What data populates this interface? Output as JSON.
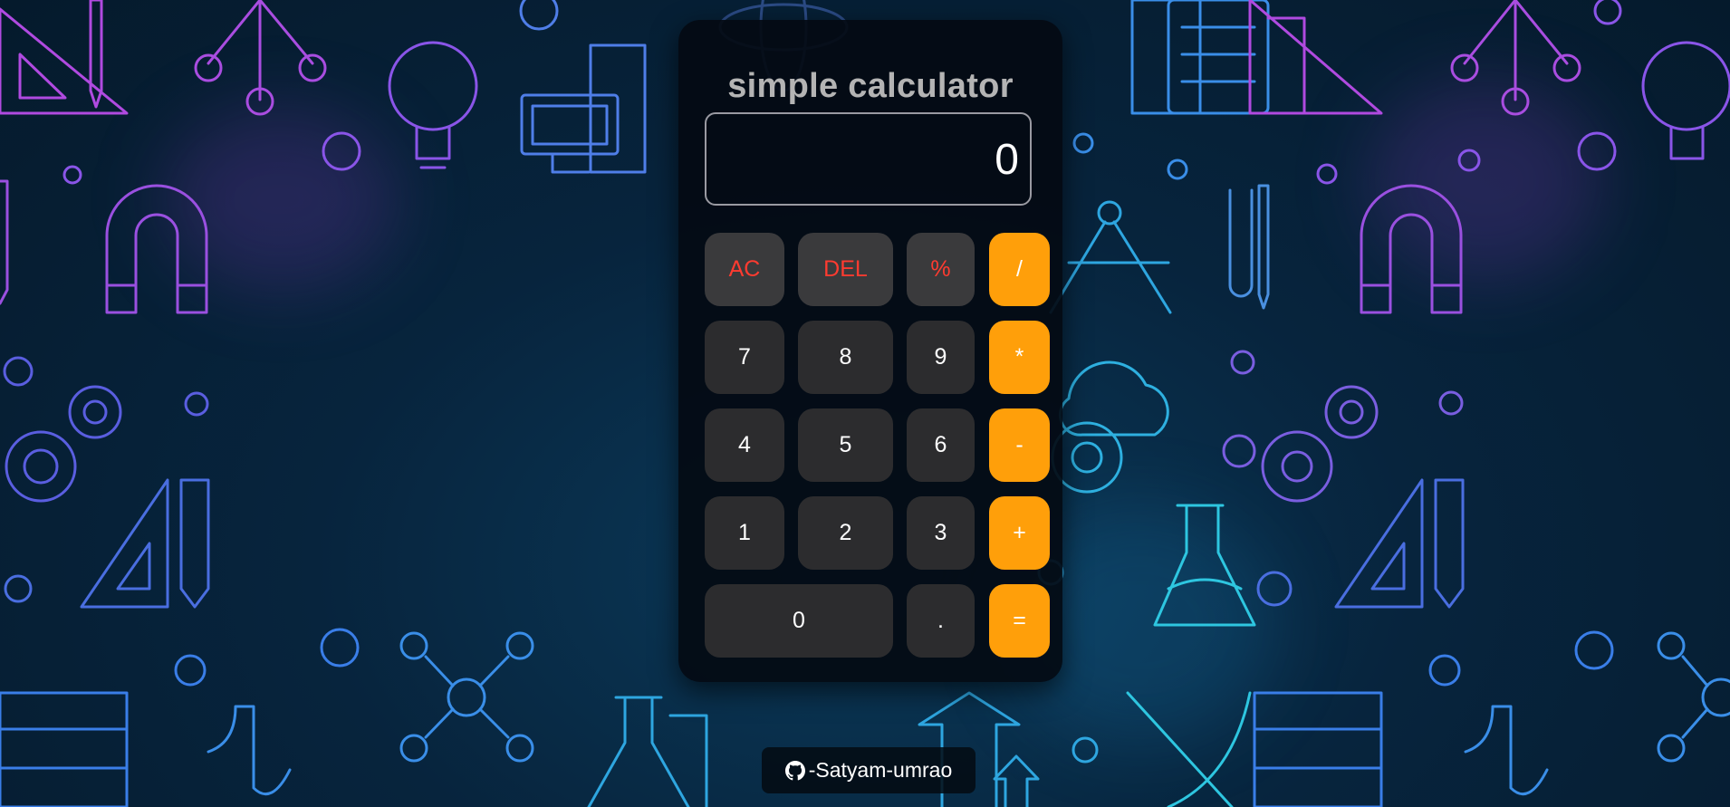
{
  "calculator": {
    "title": "simple calculator",
    "display_value": "0",
    "buttons": {
      "ac": "AC",
      "del": "DEL",
      "percent": "%",
      "divide": "/",
      "seven": "7",
      "eight": "8",
      "nine": "9",
      "multiply": "*",
      "four": "4",
      "five": "5",
      "six": "6",
      "subtract": "-",
      "one": "1",
      "two": "2",
      "three": "3",
      "add": "+",
      "zero": "0",
      "decimal": ".",
      "equals": "="
    }
  },
  "footer": {
    "github_label": "-Satyam-umrao",
    "icon": "github-icon"
  },
  "colors": {
    "operator": "#ff9f0a",
    "function_text": "#ff3b30",
    "button_bg": "#2c2c2e",
    "background": "#07243d"
  },
  "background_icons": [
    "set-square-icon",
    "pendulum-icon",
    "lightbulb-icon",
    "pi-calculator-icon",
    "atom-icon",
    "magnet-icon",
    "gear-icon",
    "compass-icon",
    "cloud-gear-icon",
    "flask-icon",
    "test-tube-icon",
    "molecule-icon",
    "binary-grid-icon",
    "graph-icon"
  ]
}
